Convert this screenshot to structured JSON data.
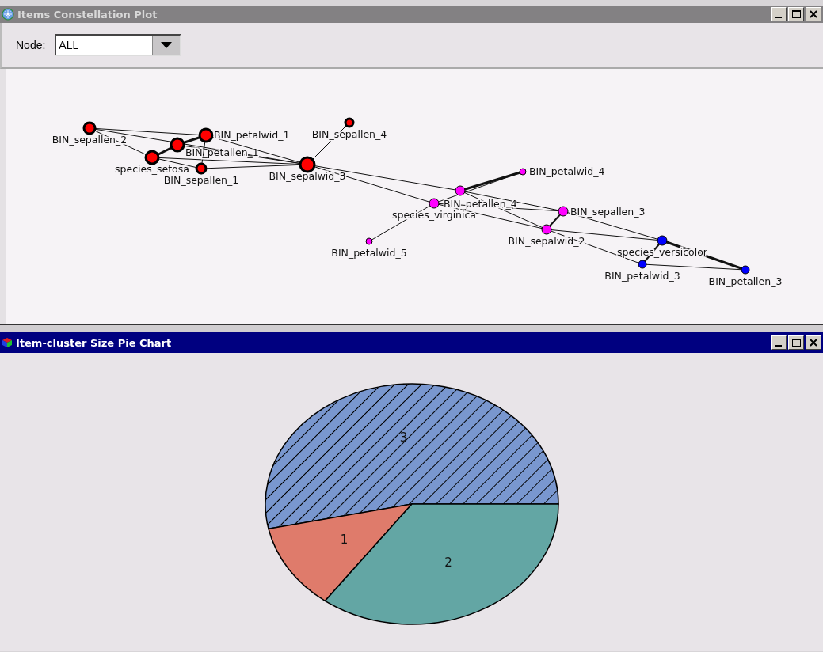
{
  "constellation_window": {
    "title": "Items Constellation Plot",
    "active": false,
    "node_filter": {
      "label": "Node:",
      "value": "ALL"
    },
    "nodes": [
      {
        "label": "BIN_sepallen_2",
        "color": "#ff0000"
      },
      {
        "label": "BIN_petalwid_1",
        "color": "#ff0000"
      },
      {
        "label": "BIN_petallen_1",
        "color": "#ff0000"
      },
      {
        "label": "species_setosa",
        "color": "#ff0000"
      },
      {
        "label": "BIN_sepallen_1",
        "color": "#ff0000"
      },
      {
        "label": "BIN_sepalwid_3",
        "color": "#ff0000"
      },
      {
        "label": "BIN_sepallen_4",
        "color": "#ff0000"
      },
      {
        "label": "BIN_petalwid_4",
        "color": "#ff00ff"
      },
      {
        "label": "BIN_petallen_4",
        "color": "#ff00ff"
      },
      {
        "label": "species_virginica",
        "color": "#ff00ff"
      },
      {
        "label": "BIN_sepallen_3",
        "color": "#ff00ff"
      },
      {
        "label": "BIN_sepalwid_2",
        "color": "#ff00ff"
      },
      {
        "label": "BIN_petalwid_5",
        "color": "#ff00ff"
      },
      {
        "label": "species_versicolor",
        "color": "#0000ff"
      },
      {
        "label": "BIN_petalwid_3",
        "color": "#0000ff"
      },
      {
        "label": "BIN_petallen_3",
        "color": "#0000ff"
      }
    ]
  },
  "pie_window": {
    "title": "Item-cluster Size Pie Chart",
    "active": true,
    "slice_labels": [
      "3",
      "1",
      "2"
    ]
  }
}
